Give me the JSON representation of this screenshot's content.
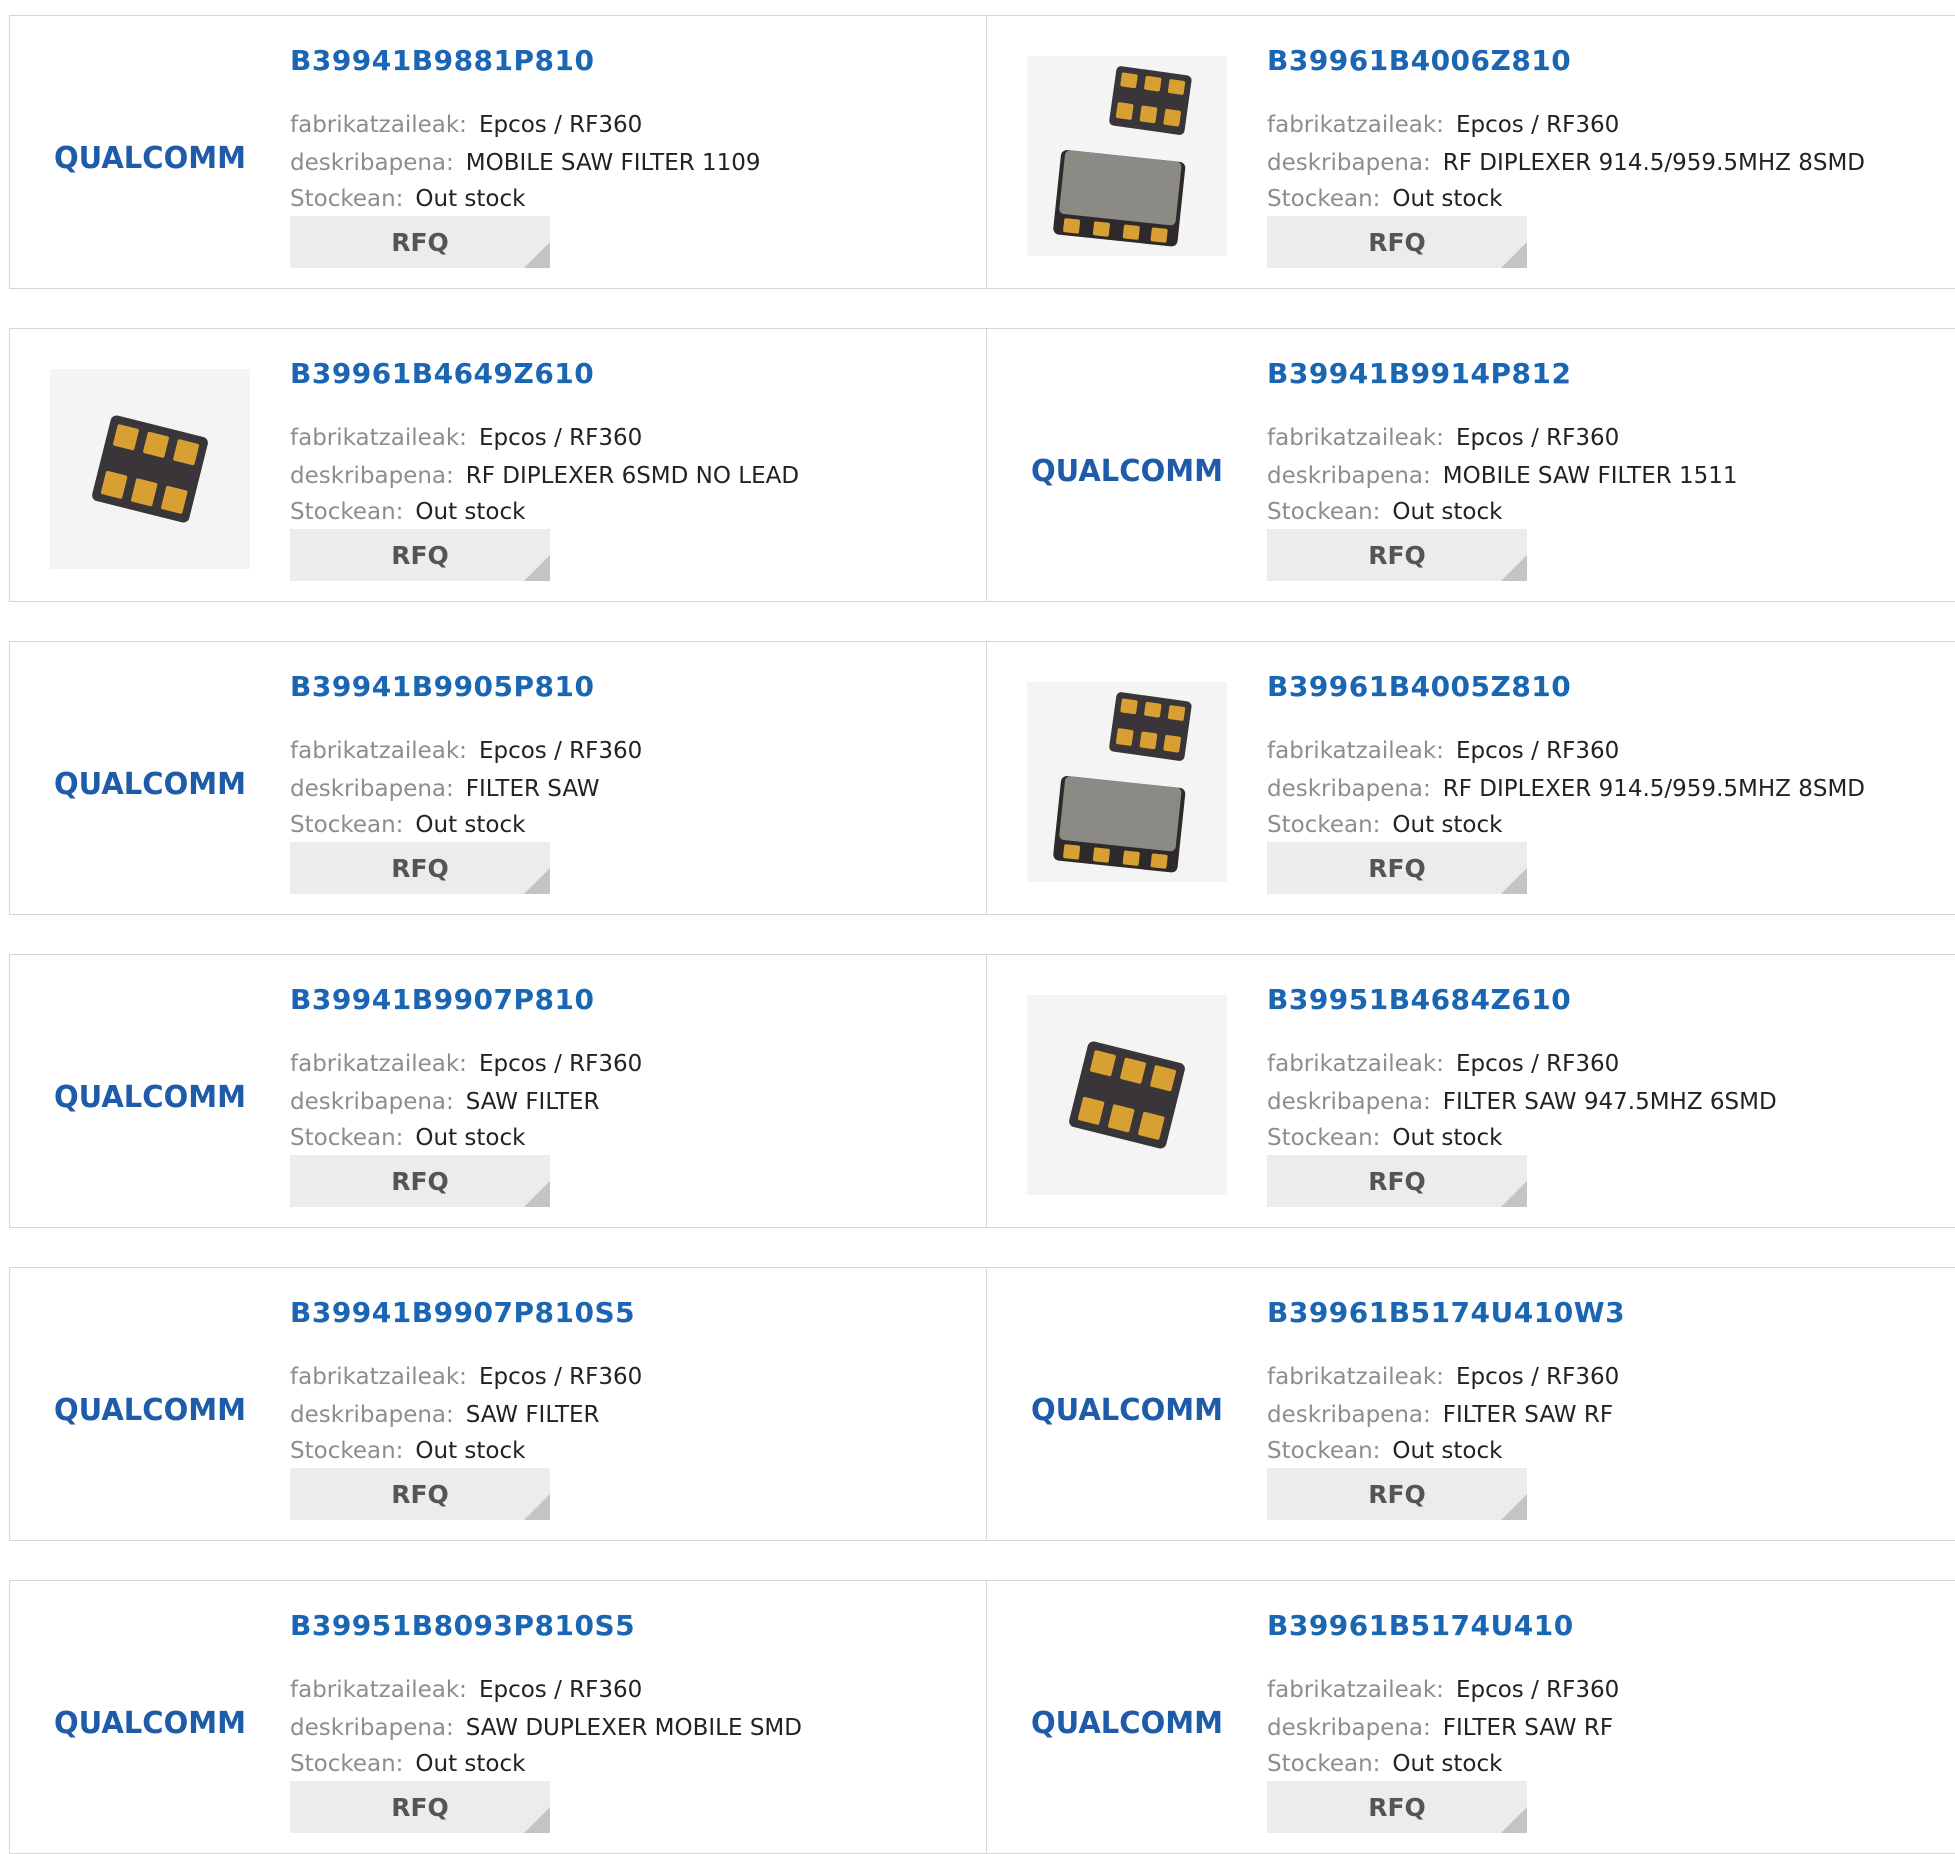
{
  "labels": {
    "manufacturer": "fabrikatzaileak:",
    "description": "deskribapena:",
    "stock": "Stockean:",
    "rfq": "RFQ"
  },
  "logo_text": "QUALCOMM",
  "colors": {
    "link": "#1a66b3",
    "label": "#8d8d8d",
    "border": "#d6d6d6",
    "rfq_bg": "#ececec"
  },
  "products": [
    {
      "part": "B39941B9881P810",
      "manufacturer": "Epcos / RF360",
      "description": "MOBILE SAW FILTER 1109",
      "stock": "Out stock",
      "image": "qualcomm-logo"
    },
    {
      "part": "B39961B4006Z810",
      "manufacturer": "Epcos / RF360",
      "description": "RF DIPLEXER 914.5/959.5MHZ 8SMD",
      "stock": "Out stock",
      "image": "chip-pair"
    },
    {
      "part": "B39961B4649Z610",
      "manufacturer": "Epcos / RF360",
      "description": "RF DIPLEXER 6SMD NO LEAD",
      "stock": "Out stock",
      "image": "chip-6pad"
    },
    {
      "part": "B39941B9914P812",
      "manufacturer": "Epcos / RF360",
      "description": "MOBILE SAW FILTER 1511",
      "stock": "Out stock",
      "image": "qualcomm-logo"
    },
    {
      "part": "B39941B9905P810",
      "manufacturer": "Epcos / RF360",
      "description": "FILTER SAW",
      "stock": "Out stock",
      "image": "qualcomm-logo"
    },
    {
      "part": "B39961B4005Z810",
      "manufacturer": "Epcos / RF360",
      "description": "RF DIPLEXER 914.5/959.5MHZ 8SMD",
      "stock": "Out stock",
      "image": "chip-pair"
    },
    {
      "part": "B39941B9907P810",
      "manufacturer": "Epcos / RF360",
      "description": "SAW FILTER",
      "stock": "Out stock",
      "image": "qualcomm-logo"
    },
    {
      "part": "B39951B4684Z610",
      "manufacturer": "Epcos / RF360",
      "description": "FILTER SAW 947.5MHZ 6SMD",
      "stock": "Out stock",
      "image": "chip-6pad"
    },
    {
      "part": "B39941B9907P810S5",
      "manufacturer": "Epcos / RF360",
      "description": "SAW FILTER",
      "stock": "Out stock",
      "image": "qualcomm-logo"
    },
    {
      "part": "B39961B5174U410W3",
      "manufacturer": "Epcos / RF360",
      "description": "FILTER SAW RF",
      "stock": "Out stock",
      "image": "qualcomm-logo"
    },
    {
      "part": "B39951B8093P810S5",
      "manufacturer": "Epcos / RF360",
      "description": "SAW DUPLEXER MOBILE SMD",
      "stock": "Out stock",
      "image": "qualcomm-logo"
    },
    {
      "part": "B39961B5174U410",
      "manufacturer": "Epcos / RF360",
      "description": "FILTER SAW RF",
      "stock": "Out stock",
      "image": "qualcomm-logo"
    }
  ]
}
